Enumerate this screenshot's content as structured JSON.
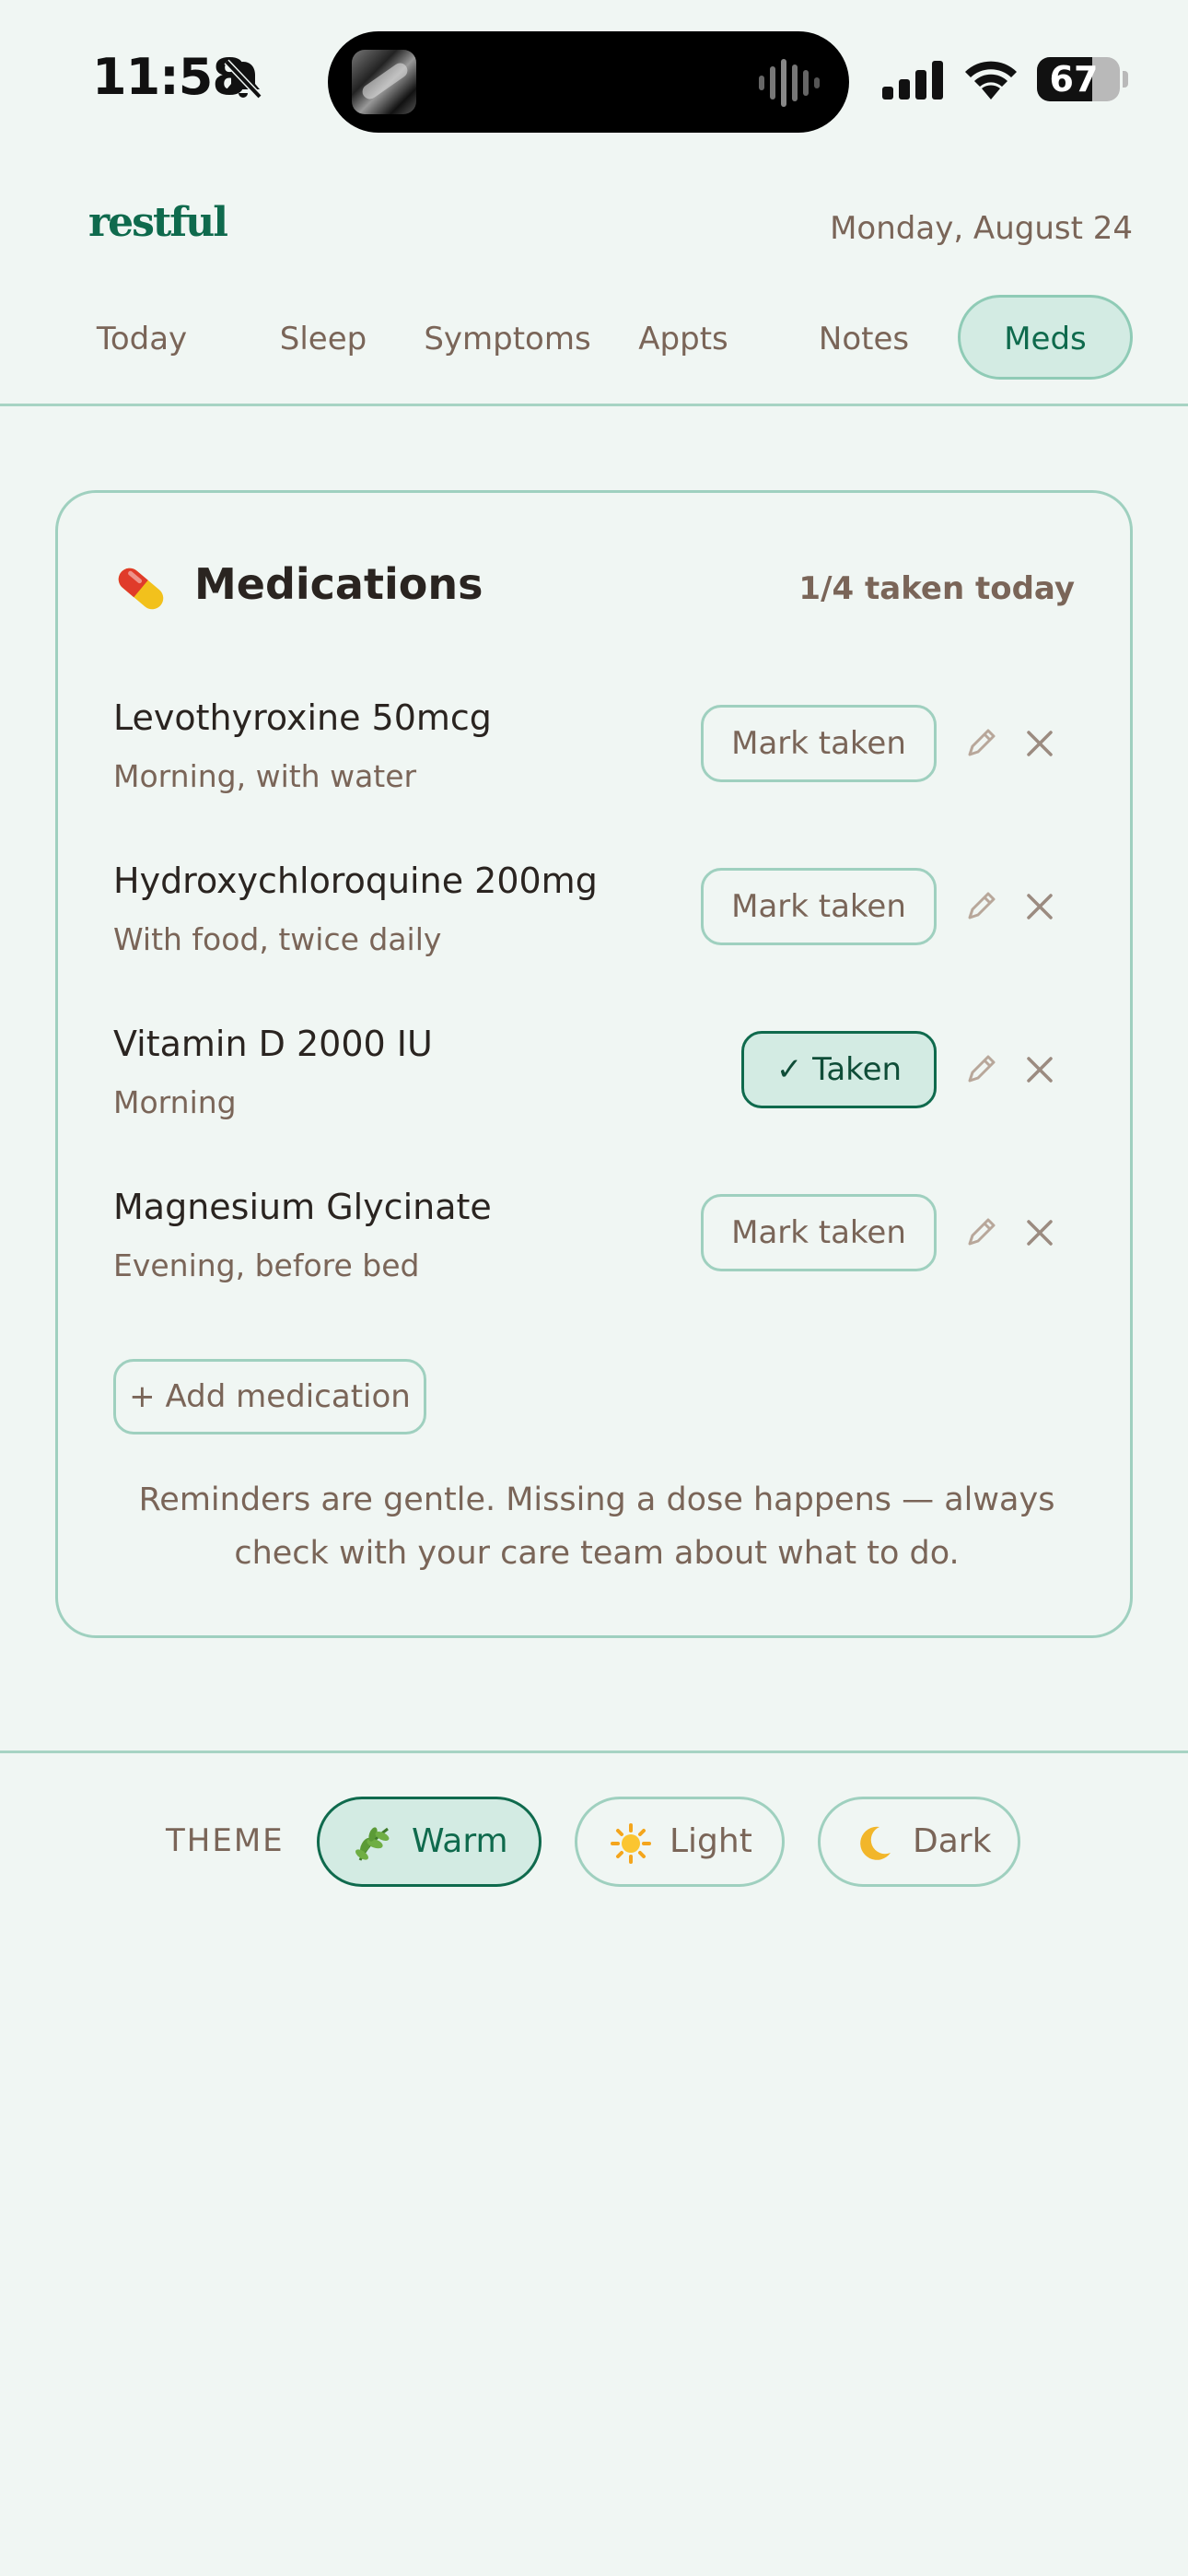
{
  "status_bar": {
    "time": "11:58",
    "battery_level": "67",
    "battery_fraction": 0.67
  },
  "header": {
    "logo": "restful",
    "date": "Monday, August 24"
  },
  "nav": {
    "tabs": [
      "Today",
      "Sleep",
      "Symptoms",
      "Appts",
      "Notes",
      "Meds"
    ],
    "active": "Meds"
  },
  "medications": {
    "title": "Medications",
    "taken_summary": "1/4 taken today",
    "items": [
      {
        "name": "Levothyroxine 50mcg",
        "note": "Morning, with water",
        "button": "Mark taken",
        "taken": false
      },
      {
        "name": "Hydroxychloroquine 200mg",
        "note": "With food, twice daily",
        "button": "Mark taken",
        "taken": false
      },
      {
        "name": "Vitamin D 2000 IU",
        "note": "Morning",
        "button": "✓ Taken",
        "taken": true
      },
      {
        "name": "Magnesium Glycinate",
        "note": "Evening, before bed",
        "button": "Mark taken",
        "taken": false
      }
    ],
    "add_button": "+ Add medication",
    "footnote": "Reminders are gentle. Missing a dose happens — always check with your care team about what to do."
  },
  "theme": {
    "label": "THEME",
    "options": [
      {
        "label": "Warm",
        "icon": "herb-icon",
        "active": true
      },
      {
        "label": "Light",
        "icon": "sun-icon",
        "active": false
      },
      {
        "label": "Dark",
        "icon": "moon-icon",
        "active": false
      }
    ]
  },
  "colors": {
    "background": "#f0f6f3",
    "accent": "#0f6a4d",
    "accent_soft": "#d3ebe3",
    "border": "#9fd0bf",
    "muted_text": "#7a6558"
  },
  "icons": [
    "bell-slash-icon",
    "cellular-signal-icon",
    "wifi-icon",
    "battery-icon",
    "pill-icon",
    "pencil-icon",
    "close-icon"
  ]
}
